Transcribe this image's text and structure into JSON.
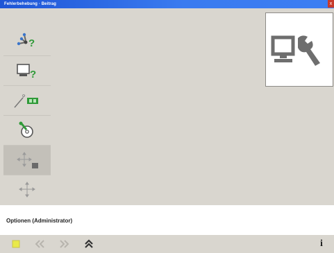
{
  "window": {
    "title": "Fehlerbehebung · Beitrag",
    "close_label": "x"
  },
  "sidebar": {
    "items": [
      {
        "icon": "network-help-icon"
      },
      {
        "icon": "computer-help-icon"
      },
      {
        "icon": "tool-card-icon"
      },
      {
        "icon": "disc-wrench-icon"
      },
      {
        "icon": "move-options-icon",
        "active": true
      },
      {
        "icon": "move-icon"
      }
    ]
  },
  "logo": {
    "icon": "computer-wrench-icon"
  },
  "status": {
    "text": "Optionen (Administrator)"
  },
  "toolbar": {
    "buttons": [
      {
        "icon": "home-icon"
      },
      {
        "icon": "back-icon"
      },
      {
        "icon": "forward-icon"
      },
      {
        "icon": "up-icon"
      }
    ],
    "info_label": "i"
  },
  "colors": {
    "background": "#d9d6cf",
    "titlebar": "#2f6be6",
    "help_green": "#2f9a38",
    "accent_yellow": "#e9e94a"
  }
}
